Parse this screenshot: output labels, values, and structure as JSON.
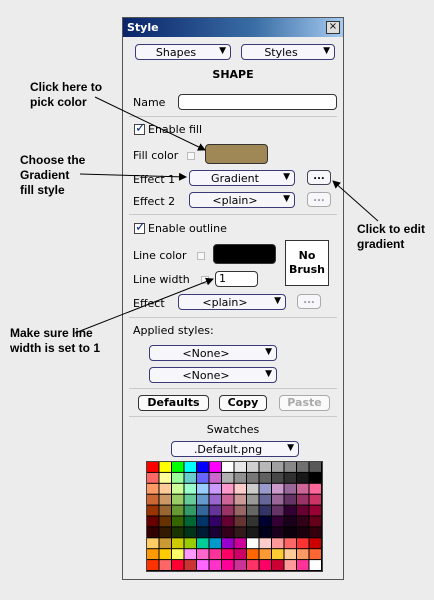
{
  "annotations": {
    "pick_color": "Click here to\npick color",
    "gradient_style": "Choose the\nGradient\nfill style",
    "edit_gradient": "Click to edit\ngradient",
    "line_width": "Make sure line\nwidth is set to 1"
  },
  "window": {
    "title": "Style",
    "close": "×"
  },
  "top": {
    "shapes": "Shapes",
    "styles": "Styles",
    "heading": "SHAPE"
  },
  "name_label": "Name",
  "name_value": "",
  "fill": {
    "enable_label": "Enable fill",
    "enabled": true,
    "color_label": "Fill color",
    "color": "#a08756",
    "effect1_label": "Effect 1",
    "effect1_value": "Gradient",
    "effect2_label": "Effect 2",
    "effect2_value": "<plain>",
    "more": "..."
  },
  "outline": {
    "enable_label": "Enable outline",
    "enabled": true,
    "color_label": "Line color",
    "color": "#000000",
    "width_label": "Line width",
    "width_value": "1",
    "no_brush": "No Brush",
    "effect_label": "Effect",
    "effect_value": "<plain>",
    "more": "..."
  },
  "applied": {
    "label": "Applied styles:",
    "style1": "<None>",
    "style2": "<None>"
  },
  "buttons": {
    "defaults": "Defaults",
    "copy": "Copy",
    "paste": "Paste"
  },
  "swatches": {
    "label": "Swatches",
    "file": ".Default.png"
  },
  "palette": {
    "cols": 14,
    "rows": [
      [
        "#ff0000",
        "#ffff00",
        "#00ff00",
        "#00ffff",
        "#0000ff",
        "#ff00ff",
        "#ffffff",
        "#e8e8e8",
        "#d0d0d0",
        "#b8b8b8",
        "#a0a0a0",
        "#888888",
        "#707070",
        "#585858"
      ],
      [
        "#ff6666",
        "#ffff99",
        "#99ff99",
        "#66cccc",
        "#6666ff",
        "#cc66cc",
        "#b0b0b0",
        "#909090",
        "#787878",
        "#606060",
        "#484848",
        "#303030",
        "#181818",
        "#000000"
      ],
      [
        "#ff9966",
        "#ffcc99",
        "#ccff99",
        "#99ffcc",
        "#99ccff",
        "#cc99ff",
        "#ff99cc",
        "#ffcccc",
        "#cccccc",
        "#9999cc",
        "#cc99cc",
        "#996699",
        "#cc6699",
        "#ff6699"
      ],
      [
        "#cc6633",
        "#cc9966",
        "#99cc66",
        "#66cc99",
        "#6699cc",
        "#9966cc",
        "#cc6699",
        "#cc9999",
        "#999999",
        "#666699",
        "#996699",
        "#663366",
        "#993366",
        "#cc3366"
      ],
      [
        "#993300",
        "#996633",
        "#669933",
        "#339966",
        "#336699",
        "#663399",
        "#993366",
        "#996666",
        "#666666",
        "#333366",
        "#663366",
        "#330033",
        "#660033",
        "#990033"
      ],
      [
        "#660000",
        "#663300",
        "#336600",
        "#006633",
        "#003366",
        "#330066",
        "#660033",
        "#663333",
        "#333333",
        "#000033",
        "#330033",
        "#1a001a",
        "#330019",
        "#66001a"
      ],
      [
        "#330000",
        "#331a00",
        "#1a3300",
        "#00331a",
        "#001a33",
        "#1a0033",
        "#33001a",
        "#331a1a",
        "#1a1a1a",
        "#00001a",
        "#1a001a",
        "#0d000d",
        "#1a000d",
        "#33000d"
      ],
      [
        "#ffcc66",
        "#cc9933",
        "#cccc00",
        "#99cc00",
        "#00cc99",
        "#0099cc",
        "#9900cc",
        "#cc0099",
        "#ffffff",
        "#ffcccc",
        "#ff9999",
        "#ff6666",
        "#ff3333",
        "#cc0000"
      ],
      [
        "#ff9900",
        "#ffcc00",
        "#ffff66",
        "#ff99ff",
        "#ff66cc",
        "#ff3399",
        "#ff0066",
        "#cc0066",
        "#ff6600",
        "#ff9933",
        "#ffcc33",
        "#ffcc99",
        "#ff9966",
        "#ff6633"
      ],
      [
        "#ff3300",
        "#ff6666",
        "#ff0033",
        "#cc3333",
        "#ff66ff",
        "#ff33cc",
        "#ff0099",
        "#cc3399",
        "#ff3366",
        "#ff0066",
        "#cc0033",
        "#ff9999",
        "#ff3399",
        "#ffffff"
      ]
    ]
  }
}
